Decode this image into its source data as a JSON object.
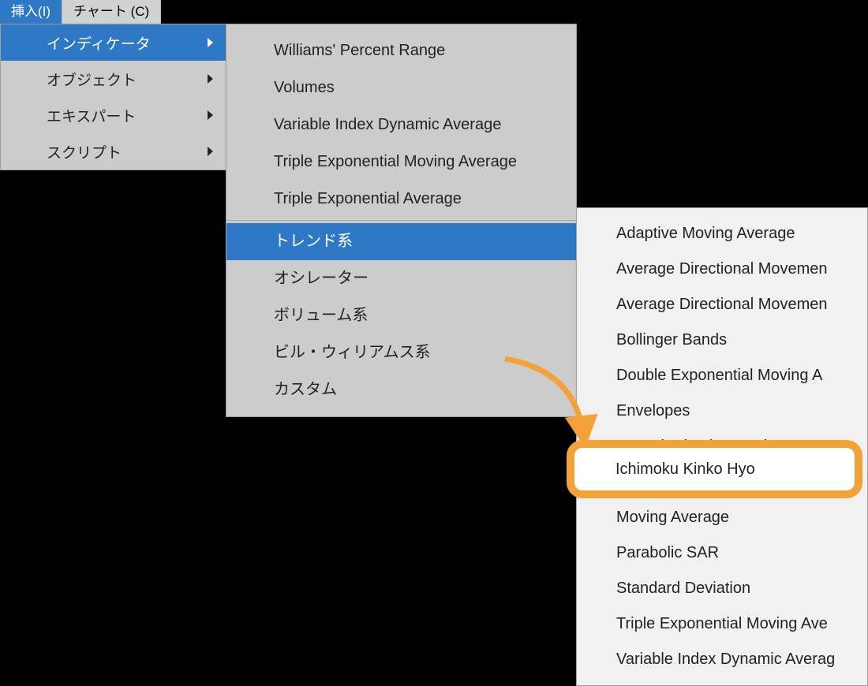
{
  "menubar": {
    "insert": "挿入(I)",
    "chart": "チャート (C)"
  },
  "menu1": {
    "items": [
      {
        "label": "インディケータ",
        "has_arrow": true,
        "highlight": true
      },
      {
        "label": "オブジェクト",
        "has_arrow": true,
        "highlight": false
      },
      {
        "label": "エキスパート",
        "has_arrow": true,
        "highlight": false
      },
      {
        "label": "スクリプト",
        "has_arrow": true,
        "highlight": false
      }
    ]
  },
  "menu2": {
    "top_items": [
      "Williams' Percent Range",
      "Volumes",
      "Variable Index Dynamic Average",
      "Triple Exponential Moving Average",
      "Triple Exponential Average"
    ],
    "bottom_items": [
      {
        "label": "トレンド系",
        "highlight": true
      },
      {
        "label": "オシレーター",
        "highlight": false
      },
      {
        "label": "ボリューム系",
        "highlight": false
      },
      {
        "label": "ビル・ウィリアムス系",
        "highlight": false
      },
      {
        "label": "カスタム",
        "highlight": false
      }
    ]
  },
  "menu3": {
    "items": [
      "Adaptive Moving Average",
      "Average Directional Movemen",
      "Average Directional Movemen",
      "Bollinger Bands",
      "Double Exponential Moving A",
      "Envelopes",
      "Fractal Adaptive Moving Aver",
      "Ichimoku Kinko Hyo",
      "Moving Average",
      "Parabolic SAR",
      "Standard Deviation",
      "Triple Exponential Moving Ave",
      "Variable Index Dynamic Averag"
    ]
  },
  "highlighted": "Ichimoku Kinko Hyo",
  "annotation": {
    "color": "#f2a239"
  }
}
